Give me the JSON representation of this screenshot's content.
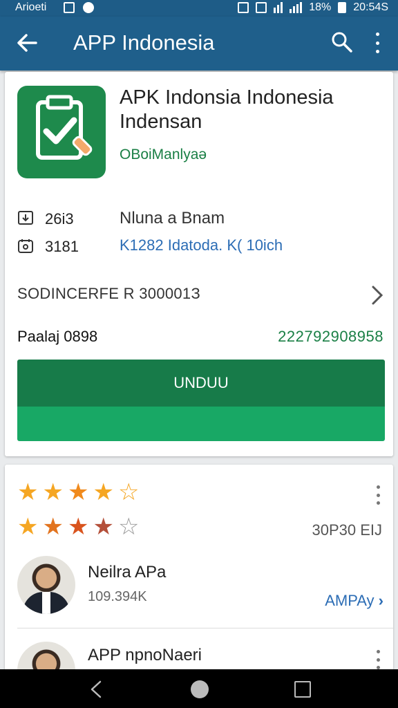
{
  "status_bar": {
    "carrier": "Arioeti",
    "battery_percent": "18%",
    "time": "20:54S"
  },
  "app_bar": {
    "title": "APP Indonesia",
    "back_icon": "arrow-left-icon",
    "search_icon": "search-icon",
    "more_icon": "more-vert-icon"
  },
  "app": {
    "icon": "clipboard-check-icon",
    "title": "APK Indonsia Indonesia Indensan",
    "subtitle": "OBoiManlyaə",
    "stats": [
      {
        "icon": "download-icon",
        "value": "26i3"
      },
      {
        "icon": "calendar-icon",
        "value": "3181"
      }
    ],
    "developer_name": "Nluna a Bnam",
    "developer_link": "K1282 Idatoda. K( 10ich",
    "section_label": "SODINCERFE R 300001З",
    "price_label": "Paalaj 0898",
    "price_value": "222792908958",
    "install_label": "UNDUU"
  },
  "ratings": {
    "row1_stars": [
      "★",
      "★",
      "★",
      "★",
      "☆"
    ],
    "row2_stars": [
      "★",
      "★",
      "★",
      "★",
      "☆"
    ],
    "count": "30P30 EIJ"
  },
  "reviews": [
    {
      "name": "Neilra APa",
      "meta": "109.394K",
      "link": "AMPAy"
    },
    {
      "name": "APP npnoNaeri",
      "meta": "",
      "link": ""
    }
  ],
  "colors": {
    "app_bar": "#1f5f8b",
    "brand_green": "#177b49",
    "install_bottom": "#18a865",
    "link_blue": "#2c6db5",
    "star_gold": "#f5a623",
    "star_orange": "#e2741f"
  }
}
